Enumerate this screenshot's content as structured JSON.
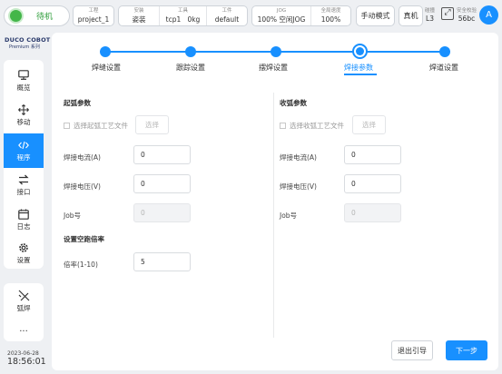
{
  "topbar": {
    "status": "待机",
    "project": {
      "label": "工程",
      "value": "project_1"
    },
    "install": {
      "label": "安装",
      "value": "姿装"
    },
    "tool": {
      "label": "工具",
      "value1": "tcp1",
      "value2": "0kg"
    },
    "workpiece": {
      "label": "工件",
      "value": "default"
    },
    "jog": {
      "label": "JOG",
      "value": "100% 空闲JOG"
    },
    "global_speed": {
      "label": "全局速度",
      "value": "100%"
    },
    "manual_mode": "手动模式",
    "real_machine": "真机",
    "level": {
      "label": "碰撞",
      "value": "L3"
    },
    "safety": {
      "label": "安全校验",
      "value": "56bc"
    },
    "avatar": "A"
  },
  "logo": {
    "line1": "DUCO COBOT",
    "line2": "Premium 系列"
  },
  "sidebar": {
    "items": [
      {
        "label": "概览",
        "icon": "monitor-icon"
      },
      {
        "label": "移动",
        "icon": "move-icon"
      },
      {
        "label": "程序",
        "icon": "code-icon"
      },
      {
        "label": "接口",
        "icon": "exchange-icon"
      },
      {
        "label": "日志",
        "icon": "calendar-icon"
      },
      {
        "label": "设置",
        "icon": "gear-icon"
      }
    ],
    "extra": [
      {
        "label": "弧焊",
        "icon": "welding-icon"
      },
      {
        "label": "...",
        "icon": "more-icon"
      }
    ]
  },
  "datetime": {
    "date": "2023-06-28",
    "time": "18:56:01"
  },
  "stepper": {
    "steps": [
      "焊缝设置",
      "跟踪设置",
      "摆焊设置",
      "焊接参数",
      "焊道设置"
    ],
    "current": 3
  },
  "arc_start": {
    "title": "起弧参数",
    "checkbox": "选择起弧工艺文件",
    "select_btn": "选择",
    "current_label": "焊接电流(A)",
    "current_value": "0",
    "voltage_label": "焊接电压(V)",
    "voltage_value": "0",
    "job_label": "Job号",
    "job_value": "0",
    "speed_title": "设置空跑倍率",
    "ratio_label": "倍率(1-10)",
    "ratio_value": "5"
  },
  "arc_end": {
    "title": "收弧参数",
    "checkbox": "选择收弧工艺文件",
    "select_btn": "选择",
    "current_label": "焊接电流(A)",
    "current_value": "0",
    "voltage_label": "焊接电压(V)",
    "voltage_value": "0",
    "job_label": "Job号",
    "job_value": "0"
  },
  "footer": {
    "exit": "退出引导",
    "next": "下一步"
  },
  "colors": {
    "accent": "#1890ff",
    "status_green": "#43b649"
  }
}
